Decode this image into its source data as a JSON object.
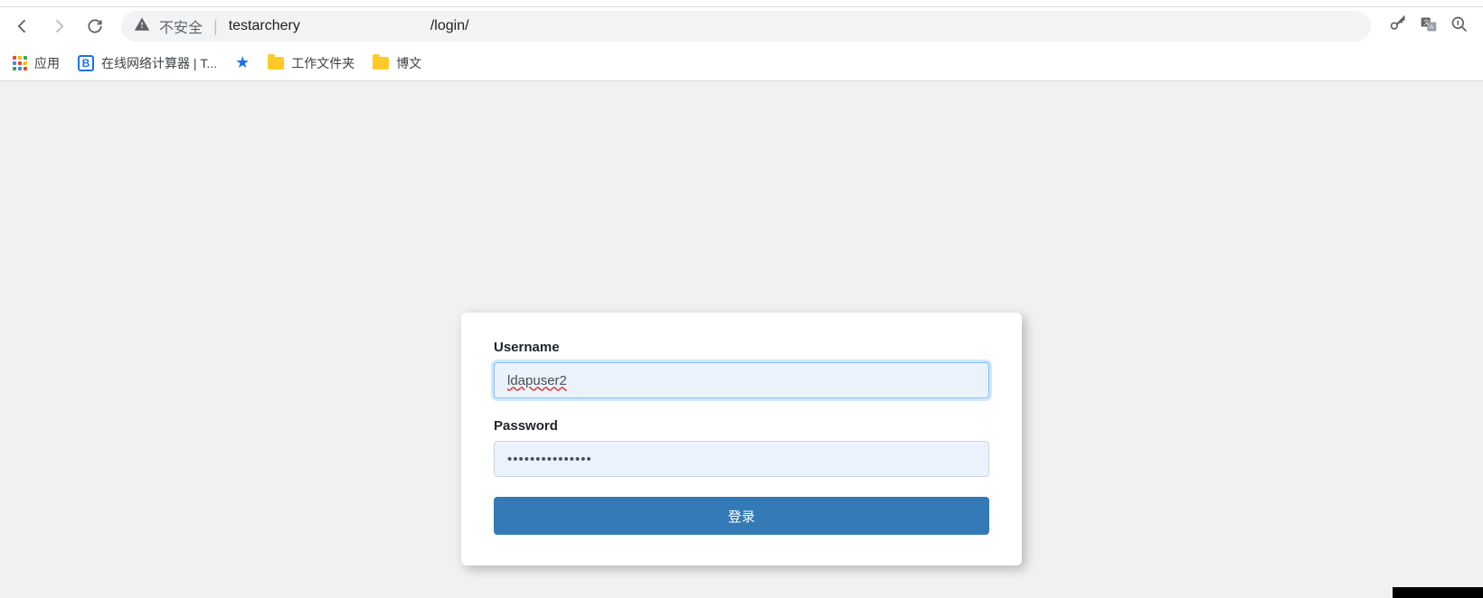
{
  "browser": {
    "not_secure_label": "不安全",
    "url_prefix": "testarchery",
    "url_suffix": "/login/"
  },
  "bookmarks": {
    "apps_label": "应用",
    "items": [
      {
        "label": "在线网络计算器 | T..."
      },
      {
        "label": ""
      },
      {
        "label": "工作文件夹"
      },
      {
        "label": "博文"
      }
    ]
  },
  "login": {
    "username_label": "Username",
    "username_value": "ldapuser2",
    "password_label": "Password",
    "password_value": "•••••••••••••••",
    "submit_label": "登录"
  }
}
